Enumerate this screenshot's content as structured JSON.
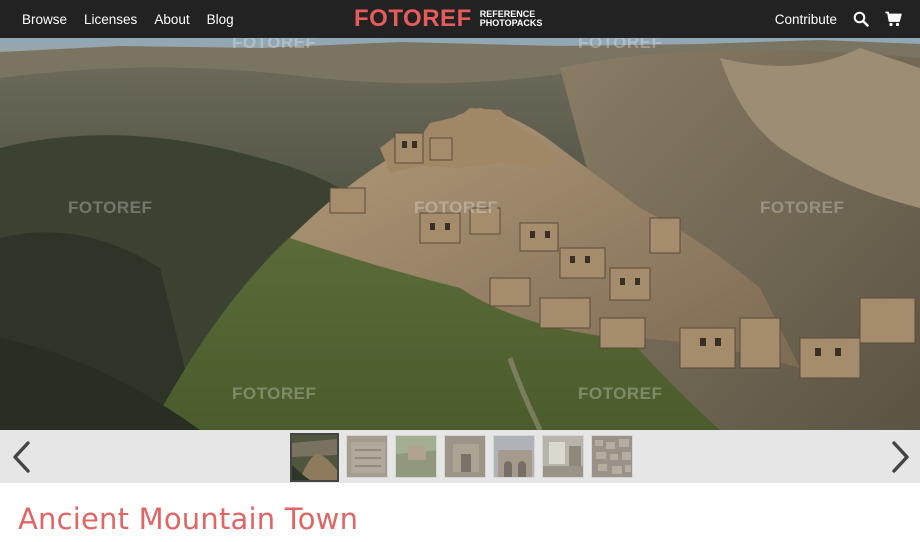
{
  "nav": {
    "links": [
      "Browse",
      "Licenses",
      "About",
      "Blog"
    ],
    "brand": "FOTOREF",
    "tagline_line1": "REFERENCE",
    "tagline_line2": "PHOTOPACKS",
    "contribute": "Contribute",
    "icons": [
      "search-icon",
      "cart-icon"
    ]
  },
  "hero": {
    "watermark": "FOTOREF"
  },
  "gallery": {
    "prev_icon": "chevron-left-icon",
    "next_icon": "chevron-right-icon",
    "thumbnail_count": 7,
    "active_index": 0
  },
  "page": {
    "title": "Ancient Mountain Town"
  },
  "colors": {
    "accent": "#e65c5c",
    "topbar": "#222222",
    "strip": "#e6e6e6"
  }
}
